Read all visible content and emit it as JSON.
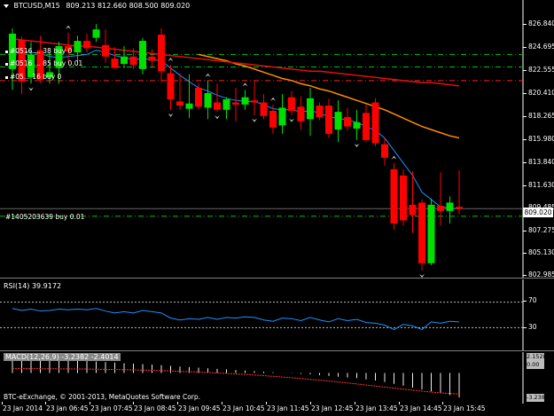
{
  "chart_header": {
    "symbol_tf": "BTCUSD,M15",
    "ohlc": "809.213 812.660 808.500 809.020"
  },
  "price_axis": [
    "826.840",
    "824.695",
    "822.555",
    "820.410",
    "818.265",
    "815.980",
    "813.840",
    "811.630",
    "809.485",
    "807.275",
    "805.130",
    "802.985"
  ],
  "current_price": "809.020",
  "order_labels": {
    "o1": "#0516 ... 38 buy 0",
    "o2": "#0516 ... 85 buy 0.01",
    "o3": "#05... 16 buy 0",
    "main": "#1405203639 buy 0.01"
  },
  "rsi": {
    "title": "RSI(14) 39.9172",
    "levels": [
      "70",
      "30"
    ]
  },
  "macd": {
    "title": "MACD(12,26,9) -3.2382 -2.4014",
    "values": [
      "2.1528",
      "0.00",
      "-3.2382"
    ]
  },
  "copyright": "BTC-eExchange, © 2001-2013, MetaQuotes Software Corp.",
  "time_axis": [
    "23 Jan 2014",
    "23 Jan 06:45",
    "23 Jan 07:45",
    "23 Jan 08:45",
    "23 Jan 09:45",
    "23 Jan 10:45",
    "23 Jan 11:45",
    "23 Jan 12:45",
    "23 Jan 13:45",
    "23 Jan 14:45",
    "23 Jan 15:45"
  ],
  "colors": {
    "bull": "#00e000",
    "bear": "#ff0000",
    "ma_fast": "#1e90ff",
    "ma_mid": "#ff8c00",
    "ma_slow": "#e01010",
    "level_green": "#00c000",
    "level_red": "#ff2020"
  },
  "chart_data": {
    "type": "candlestick",
    "symbol": "BTCUSD",
    "timeframe": "M15",
    "ylim": [
      802.5,
      828.0
    ],
    "candles": [
      {
        "o": 822.4,
        "h": 826.3,
        "l": 820.4,
        "c": 825.8
      },
      {
        "o": 825.2,
        "h": 825.5,
        "l": 820.0,
        "c": 821.2
      },
      {
        "o": 821.6,
        "h": 825.0,
        "l": 821.0,
        "c": 823.8
      },
      {
        "o": 824.2,
        "h": 825.6,
        "l": 821.1,
        "c": 821.4
      },
      {
        "o": 821.6,
        "h": 824.0,
        "l": 821.0,
        "c": 822.1
      },
      {
        "o": 822.5,
        "h": 825.0,
        "l": 821.0,
        "c": 824.6
      },
      {
        "o": 824.6,
        "h": 825.9,
        "l": 823.0,
        "c": 824.1
      },
      {
        "o": 824.0,
        "h": 825.6,
        "l": 823.0,
        "c": 825.1
      },
      {
        "o": 825.1,
        "h": 825.8,
        "l": 824.0,
        "c": 824.4
      },
      {
        "o": 825.4,
        "h": 826.7,
        "l": 825.0,
        "c": 826.2
      },
      {
        "o": 824.7,
        "h": 826.2,
        "l": 823.0,
        "c": 823.6
      },
      {
        "o": 823.4,
        "h": 824.5,
        "l": 822.9,
        "c": 822.5
      },
      {
        "o": 822.9,
        "h": 824.6,
        "l": 822.5,
        "c": 823.6
      },
      {
        "o": 823.6,
        "h": 824.4,
        "l": 822.4,
        "c": 822.8
      },
      {
        "o": 822.4,
        "h": 825.4,
        "l": 821.9,
        "c": 825.1
      },
      {
        "o": 823.6,
        "h": 824.3,
        "l": 822.5,
        "c": 823.2
      },
      {
        "o": 825.7,
        "h": 826.3,
        "l": 821.1,
        "c": 822.2
      },
      {
        "o": 822.0,
        "h": 822.8,
        "l": 818.5,
        "c": 819.5
      },
      {
        "o": 819.3,
        "h": 822.0,
        "l": 818.5,
        "c": 818.9
      },
      {
        "o": 818.6,
        "h": 821.9,
        "l": 817.7,
        "c": 819.1
      },
      {
        "o": 820.6,
        "h": 821.0,
        "l": 818.5,
        "c": 818.8
      },
      {
        "o": 818.7,
        "h": 821.3,
        "l": 817.6,
        "c": 820.1
      },
      {
        "o": 819.2,
        "h": 821.0,
        "l": 818.3,
        "c": 818.5
      },
      {
        "o": 818.5,
        "h": 819.7,
        "l": 817.6,
        "c": 819.5
      },
      {
        "o": 819.2,
        "h": 820.6,
        "l": 817.4,
        "c": 819.0
      },
      {
        "o": 819.0,
        "h": 820.4,
        "l": 818.5,
        "c": 819.7
      },
      {
        "o": 819.4,
        "h": 821.3,
        "l": 818.0,
        "c": 819.2
      },
      {
        "o": 819.2,
        "h": 820.0,
        "l": 817.6,
        "c": 817.9
      },
      {
        "o": 818.4,
        "h": 819.0,
        "l": 816.2,
        "c": 816.8
      },
      {
        "o": 817.0,
        "h": 820.0,
        "l": 816.2,
        "c": 818.7
      },
      {
        "o": 819.7,
        "h": 820.3,
        "l": 818.0,
        "c": 818.4
      },
      {
        "o": 818.8,
        "h": 819.8,
        "l": 816.6,
        "c": 817.4
      },
      {
        "o": 817.6,
        "h": 820.6,
        "l": 816.0,
        "c": 819.6
      },
      {
        "o": 818.9,
        "h": 819.2,
        "l": 817.5,
        "c": 817.8
      },
      {
        "o": 818.9,
        "h": 819.6,
        "l": 815.8,
        "c": 816.2
      },
      {
        "o": 816.6,
        "h": 819.4,
        "l": 815.4,
        "c": 818.3
      },
      {
        "o": 817.8,
        "h": 818.7,
        "l": 816.5,
        "c": 816.9
      },
      {
        "o": 816.7,
        "h": 818.5,
        "l": 815.6,
        "c": 817.3
      },
      {
        "o": 818.2,
        "h": 819.0,
        "l": 815.4,
        "c": 815.6
      },
      {
        "o": 819.2,
        "h": 819.6,
        "l": 815.0,
        "c": 815.3
      },
      {
        "o": 815.2,
        "h": 815.8,
        "l": 813.2,
        "c": 813.9
      },
      {
        "o": 812.8,
        "h": 813.4,
        "l": 807.0,
        "c": 807.6
      },
      {
        "o": 812.2,
        "h": 812.8,
        "l": 807.4,
        "c": 807.9
      },
      {
        "o": 809.4,
        "h": 812.6,
        "l": 806.7,
        "c": 808.4
      },
      {
        "o": 809.6,
        "h": 809.9,
        "l": 803.1,
        "c": 803.8
      },
      {
        "o": 803.8,
        "h": 810.0,
        "l": 803.6,
        "c": 809.4
      },
      {
        "o": 809.3,
        "h": 812.5,
        "l": 807.4,
        "c": 808.8
      },
      {
        "o": 808.8,
        "h": 810.2,
        "l": 807.6,
        "c": 809.6
      },
      {
        "o": 809.2,
        "h": 812.7,
        "l": 808.5,
        "c": 809.0
      }
    ],
    "moving_averages": [
      {
        "color": "#1e90ff",
        "values": [
          823.9,
          824.1,
          824.0,
          823.9,
          823.6,
          823.5,
          823.6,
          823.7,
          823.8,
          824.2,
          824.0,
          823.7,
          823.5,
          823.3,
          823.4,
          823.3,
          823.2,
          822.5,
          821.8,
          821.2,
          820.6,
          820.3,
          819.9,
          819.6,
          819.4,
          819.3,
          819.3,
          819.0,
          818.6,
          818.5,
          818.5,
          818.3,
          818.4,
          818.2,
          817.8,
          817.7,
          817.5,
          817.3,
          816.9,
          816.5,
          815.8,
          814.6,
          813.4,
          812.2,
          810.6,
          809.9,
          809.2,
          809.1,
          809.0
        ]
      },
      {
        "color": "#ff8c00",
        "values": [
          null,
          null,
          null,
          null,
          null,
          null,
          null,
          null,
          null,
          null,
          null,
          null,
          null,
          null,
          null,
          null,
          null,
          null,
          null,
          null,
          823.8,
          823.6,
          823.4,
          823.2,
          822.9,
          822.7,
          822.4,
          822.1,
          821.8,
          821.5,
          821.3,
          821.0,
          820.8,
          820.5,
          820.3,
          820.0,
          819.7,
          819.4,
          819.1,
          818.8,
          818.5,
          818.1,
          817.7,
          817.3,
          816.9,
          816.6,
          816.3,
          816.0,
          815.8
        ]
      },
      {
        "color": "#e01010",
        "values": [
          825.3,
          825.2,
          825.1,
          825.0,
          824.9,
          824.8,
          824.7,
          824.6,
          824.6,
          824.5,
          824.4,
          824.3,
          824.2,
          824.1,
          824.0,
          823.9,
          823.8,
          823.7,
          823.6,
          823.5,
          823.4,
          823.3,
          823.2,
          823.1,
          823.0,
          822.9,
          822.8,
          822.7,
          822.6,
          822.5,
          822.4,
          822.3,
          822.2,
          822.2,
          822.1,
          822.0,
          821.9,
          821.8,
          821.7,
          821.6,
          821.5,
          821.4,
          821.3,
          821.2,
          821.1,
          821.1,
          821.0,
          820.9,
          820.8
        ]
      }
    ],
    "levels": [
      {
        "price": 823.8,
        "color": "#00c000"
      },
      {
        "price": 822.6,
        "color": "#00c000"
      },
      {
        "price": 821.3,
        "color": "#ff2020"
      },
      {
        "price": 808.3,
        "color": "#00c000"
      }
    ],
    "rsi": {
      "ylim": [
        0,
        100
      ],
      "levels": [
        70,
        30
      ],
      "values": [
        60,
        57,
        59,
        56,
        57,
        59,
        58,
        59,
        58,
        60,
        56,
        53,
        55,
        53,
        57,
        55,
        53,
        45,
        42,
        44,
        43,
        46,
        43,
        46,
        45,
        47,
        46,
        42,
        40,
        45,
        44,
        41,
        46,
        42,
        39,
        44,
        41,
        43,
        38,
        37,
        34,
        27,
        35,
        33,
        27,
        39,
        37,
        40,
        39
      ]
    },
    "macd": {
      "ylim": [
        -3.6,
        2.3
      ],
      "values": [
        2.15,
        2.05,
        1.98,
        1.9,
        1.82,
        1.76,
        1.7,
        1.64,
        1.58,
        1.52,
        1.45,
        1.38,
        1.3,
        1.24,
        1.18,
        1.12,
        1.04,
        0.95,
        0.86,
        0.78,
        0.7,
        0.62,
        0.55,
        0.48,
        0.4,
        0.32,
        0.25,
        0.18,
        0.1,
        0.02,
        -0.05,
        -0.12,
        -0.2,
        -0.3,
        -0.4,
        -0.5,
        -0.6,
        -0.7,
        -0.85,
        -1.0,
        -1.2,
        -1.45,
        -1.7,
        -1.95,
        -2.2,
        -2.45,
        -2.7,
        -2.95,
        -3.24
      ],
      "signal": [
        0.6,
        0.59,
        0.58,
        0.57,
        0.56,
        0.55,
        0.54,
        0.53,
        0.52,
        0.5,
        0.48,
        0.46,
        0.44,
        0.41,
        0.38,
        0.35,
        0.31,
        0.27,
        0.22,
        0.17,
        0.12,
        0.06,
        0.0,
        -0.06,
        -0.13,
        -0.2,
        -0.28,
        -0.36,
        -0.45,
        -0.54,
        -0.64,
        -0.74,
        -0.85,
        -0.96,
        -1.08,
        -1.2,
        -1.33,
        -1.46,
        -1.6,
        -1.74,
        -1.88,
        -2.02,
        -2.16,
        -2.29,
        -2.42,
        -2.54,
        -2.65,
        -2.74,
        -2.8
      ]
    },
    "fractals_up": [
      6,
      17,
      21,
      25,
      28,
      41
    ],
    "fractals_down": [
      2,
      17,
      22,
      26,
      30,
      37,
      44
    ]
  }
}
